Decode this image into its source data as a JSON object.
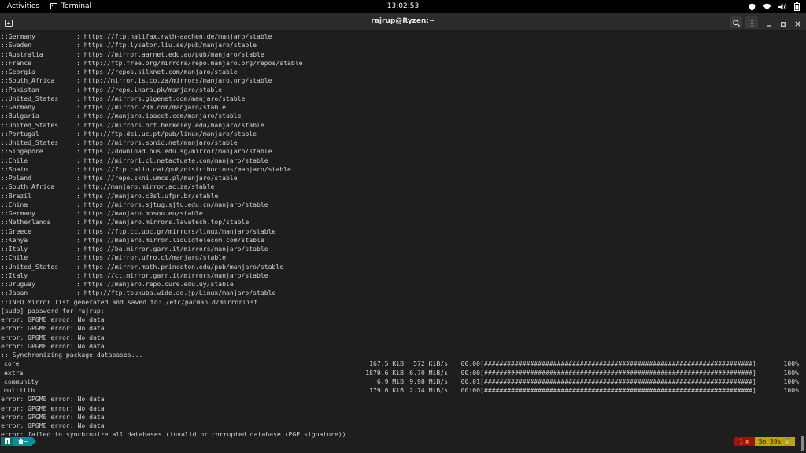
{
  "topbar": {
    "activities": "Activities",
    "app_name": "Terminal",
    "clock": "13:02:53"
  },
  "window": {
    "title": "rajrup@Ryzen:~"
  },
  "terminal": {
    "mirrors": [
      {
        "country": "::Germany",
        "url": ": https://ftp.halifax.rwth-aachen.de/manjaro/stable"
      },
      {
        "country": "::Sweden",
        "url": ": https://ftp.lysator.liu.se/pub/manjaro/stable"
      },
      {
        "country": "::Australia",
        "url": ": https://mirror.aarnet.edu.au/pub/manjaro/stable"
      },
      {
        "country": "::France",
        "url": ": http://ftp.free.org/mirrors/repo.manjaro.org/repos/stable"
      },
      {
        "country": "::Georgia",
        "url": ": https://repos.silknet.com/manjaro/stable"
      },
      {
        "country": "::South_Africa",
        "url": ": http://mirror.is.co.za/mirrors/manjaro.org/stable"
      },
      {
        "country": "::Pakistan",
        "url": ": https://repo.inara.pk/manjaro/stable"
      },
      {
        "country": "::United_States",
        "url": ": https://mirrors.gigenet.com/manjaro/stable"
      },
      {
        "country": "::Germany",
        "url": ": https://mirror.23m.com/manjaro/stable"
      },
      {
        "country": "::Bulgaria",
        "url": ": https://manjaro.ipacct.com/manjaro/stable"
      },
      {
        "country": "::United_States",
        "url": ": https://mirrors.ocf.berkeley.edu/manjaro/stable"
      },
      {
        "country": "::Portugal",
        "url": ": http://ftp.dei.uc.pt/pub/linux/manjaro/stable"
      },
      {
        "country": "::United_States",
        "url": ": https://mirrors.sonic.net/manjaro/stable"
      },
      {
        "country": "::Singapore",
        "url": ": https://download.nus.edu.sg/mirror/manjaro/stable"
      },
      {
        "country": "::Chile",
        "url": ": https://mirror1.cl.netactuate.com/manjaro/stable"
      },
      {
        "country": "::Spain",
        "url": ": https://ftp.caliu.cat/pub/distribucions/manjaro/stable"
      },
      {
        "country": "::Poland",
        "url": ": https://repo.skni.umcs.pl/manjaro/stable"
      },
      {
        "country": "::South_Africa",
        "url": ": http://manjaro.mirror.ac.za/stable"
      },
      {
        "country": "::Brazil",
        "url": ": https://manjaro.c3sl.ufpr.br/stable"
      },
      {
        "country": "::China",
        "url": ": https://mirrors.sjtug.sjtu.edu.cn/manjaro/stable"
      },
      {
        "country": "::Germany",
        "url": ": https://manjaro.moson.eu/stable"
      },
      {
        "country": "::Netherlands",
        "url": ": https://manjaro.mirrors.lavatech.top/stable"
      },
      {
        "country": "::Greece",
        "url": ": https://ftp.cc.uoc.gr/mirrors/linux/manjaro/stable"
      },
      {
        "country": "::Kenya",
        "url": ": https://manjaro.mirror.liquidtelecom.com/stable"
      },
      {
        "country": "::Italy",
        "url": ": https://ba.mirror.garr.it/mirrors/manjaro/stable"
      },
      {
        "country": "::Chile",
        "url": ": https://mirror.ufro.cl/manjaro/stable"
      },
      {
        "country": "::United_States",
        "url": ": https://mirror.math.princeton.edu/pub/manjaro/stable"
      },
      {
        "country": "::Italy",
        "url": ": https://ct.mirror.garr.it/mirrors/manjaro/stable"
      },
      {
        "country": "::Uruguay",
        "url": ": https://manjaro.repo.cure.edu.uy/stable"
      },
      {
        "country": "::Japan",
        "url": ": http://ftp.tsukuba.wide.ad.jp/Linux/manjaro/stable"
      }
    ],
    "info_line": "::INFO Mirror list generated and saved to: /etc/pacman.d/mirrorlist",
    "sudo_line": "[sudo] password for rajrup:",
    "errors_before": [
      "error: GPGME error: No data",
      "error: GPGME error: No data",
      "error: GPGME error: No data",
      "error: GPGME error: No data"
    ],
    "sync_heading": ":: Synchronizing package databases...",
    "sync_rows": [
      {
        "name": "core",
        "size": "167.5 KiB",
        "speed": "572 KiB/s",
        "time": "00:00",
        "bar": "[######################################################################]",
        "pct": "100%"
      },
      {
        "name": "extra",
        "size": "1879.6 KiB",
        "speed": "6.70 MiB/s",
        "time": "00:00",
        "bar": "[######################################################################]",
        "pct": "100%"
      },
      {
        "name": "community",
        "size": "6.9 MiB",
        "speed": "9.98 MiB/s",
        "time": "00:01",
        "bar": "[######################################################################]",
        "pct": "100%"
      },
      {
        "name": "multilib",
        "size": "179.6 KiB",
        "speed": "2.74 MiB/s",
        "time": "00:00",
        "bar": "[######################################################################]",
        "pct": "100%"
      }
    ],
    "errors_after": [
      "error: GPGME error: No data",
      "error: GPGME error: No data",
      "error: GPGME error: No data",
      "error: GPGME error: No data"
    ],
    "final_error": "error: failed to synchronize all databases (invalid or corrupted database (PGP signature))"
  },
  "prompt": {
    "dir": "~",
    "status_code": "1",
    "status_mark": "✘",
    "duration": "5m 39s",
    "hourglass": "⌛"
  },
  "icons": {
    "topbar": [
      "shield-icon",
      "wifi-icon",
      "volume-icon",
      "battery-icon"
    ],
    "header": [
      "new-tab-icon",
      "search-icon",
      "menu-icon",
      "minimize-icon",
      "maximize-icon",
      "close-icon"
    ],
    "prompt": [
      "os-icon",
      "home-icon"
    ]
  },
  "colors": {
    "terminal_bg": "#1e1e1e",
    "terminal_fg": "#d0d0d0",
    "prompt_os": "#0f6e6e",
    "prompt_dir": "#0a8f96",
    "prompt_status_bg": "#a01010",
    "prompt_status_fg": "#ff8a3a",
    "prompt_time_bg": "#b8a800"
  }
}
